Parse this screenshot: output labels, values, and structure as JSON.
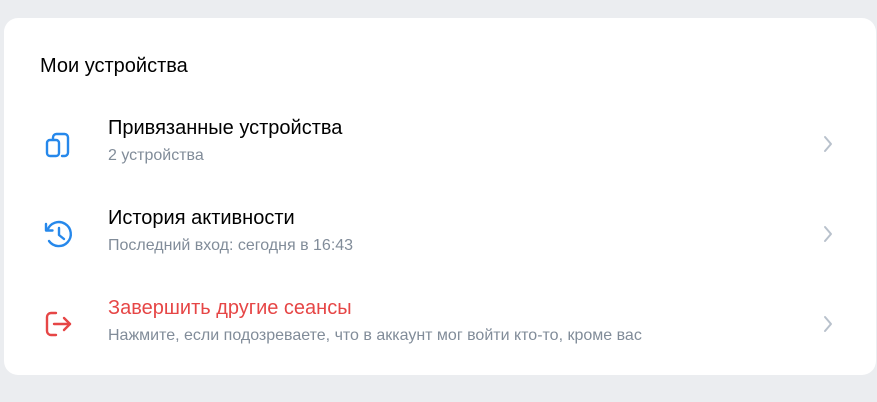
{
  "section": {
    "title": "Мои устройства"
  },
  "items": [
    {
      "title": "Привязанные устройства",
      "subtitle": "2 устройства",
      "icon": "devices-icon",
      "danger": false
    },
    {
      "title": "История активности",
      "subtitle": "Последний вход: сегодня в 16:43",
      "icon": "history-icon",
      "danger": false
    },
    {
      "title": "Завершить другие сеансы",
      "subtitle": "Нажмите, если подозреваете, что в аккаунт мог войти кто-то, кроме вас",
      "icon": "logout-icon",
      "danger": true
    }
  ],
  "colors": {
    "accent": "#2688eb",
    "danger": "#e64646",
    "secondary_text": "#818c99",
    "chevron": "#b8c1cc",
    "background": "#ebedf0",
    "card": "#ffffff"
  }
}
